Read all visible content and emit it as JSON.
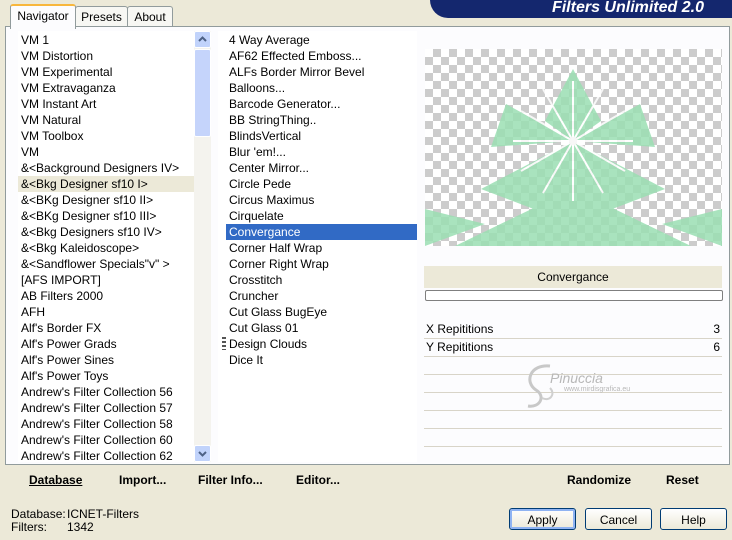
{
  "banner": "Filters Unlimited 2.0",
  "tabs": [
    "Navigator",
    "Presets",
    "About"
  ],
  "categories": [
    "VM 1",
    "VM Distortion",
    "VM Experimental",
    "VM Extravaganza",
    "VM Instant Art",
    "VM Natural",
    "VM Toolbox",
    "VM",
    "&<Background Designers IV>",
    "&<Bkg Designer sf10 I>",
    "&<BKg Designer sf10 II>",
    "&<BKg Designer sf10 III>",
    "&<Bkg Designers sf10 IV>",
    "&<Bkg Kaleidoscope>",
    "&<Sandflower Specials\"v\" >",
    "[AFS IMPORT]",
    "AB Filters 2000",
    "AFH",
    "Alf's Border FX",
    "Alf's Power Grads",
    "Alf's Power Sines",
    "Alf's Power Toys",
    "Andrew's Filter Collection 56",
    "Andrew's Filter Collection 57",
    "Andrew's Filter Collection 58",
    "Andrew's Filter Collection 60",
    "Andrew's Filter Collection 62"
  ],
  "selected_category_index": 9,
  "filters": [
    "4 Way Average",
    "AF62 Effected Emboss...",
    "ALFs Border Mirror Bevel",
    "Balloons...",
    "Barcode Generator...",
    "BB StringThing..",
    "BlindsVertical",
    "Blur 'em!...",
    "Center Mirror...",
    "Circle Pede",
    "Circus Maximus",
    "Cirquelate",
    "Convergance",
    "Corner Half Wrap",
    "Corner Right Wrap",
    "Crosstitch",
    "Cruncher",
    "Cut Glass  BugEye",
    "Cut Glass 01",
    "Design Clouds",
    "Dice It"
  ],
  "selected_filter_index": 12,
  "preview": {
    "accent": "#9bdfb3",
    "checker": "#cccccc"
  },
  "current_filter": "Convergance",
  "progress": 0,
  "params": [
    {
      "label": "X Repititions",
      "value": "3"
    },
    {
      "label": "Y Repititions",
      "value": "6"
    }
  ],
  "watermark": {
    "name": "Pinuccia",
    "url": "www.mirdisgrafica.eu"
  },
  "toolbar": {
    "database": "Database",
    "import": "Import...",
    "filter_info": "Filter Info...",
    "editor": "Editor...",
    "randomize": "Randomize",
    "reset": "Reset"
  },
  "status": {
    "database_label": "Database:",
    "database_value": "ICNET-Filters",
    "filters_label": "Filters:",
    "filters_value": "1342"
  },
  "buttons": {
    "apply": "Apply",
    "cancel": "Cancel",
    "help": "Help"
  }
}
